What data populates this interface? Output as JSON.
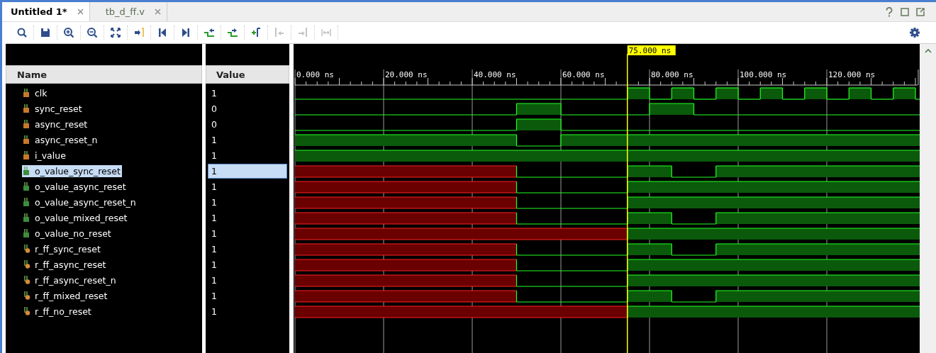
{
  "tabs": [
    {
      "label": "Untitled 1*",
      "selected": true
    },
    {
      "label": "tb_d_ff.v",
      "selected": false
    }
  ],
  "toolbar": [
    {
      "kind": "search",
      "disabled": false
    },
    {
      "kind": "save",
      "disabled": false
    },
    {
      "kind": "zoom_in",
      "disabled": false
    },
    {
      "kind": "zoom_out",
      "disabled": false
    },
    {
      "kind": "fit",
      "disabled": false
    },
    {
      "kind": "to_cursor",
      "disabled": false
    },
    {
      "kind": "first",
      "disabled": false
    },
    {
      "kind": "last",
      "disabled": false
    },
    {
      "kind": "prev_edge",
      "disabled": false
    },
    {
      "kind": "next_edge",
      "disabled": false
    },
    {
      "kind": "add_marker",
      "disabled": false
    },
    {
      "kind": "prev_marker",
      "disabled": true
    },
    {
      "kind": "next_marker",
      "disabled": true
    },
    {
      "kind": "swap",
      "disabled": true
    }
  ],
  "columns": {
    "name": "Name",
    "value": "Value"
  },
  "cursor": {
    "label": "75.000 ns"
  },
  "time_labels": [
    "0.000 ns",
    "20.000 ns",
    "40.000 ns",
    "60.000 ns",
    "80.000 ns",
    "100.000 ns",
    "120.000 ns"
  ],
  "signals": [
    {
      "name": "clk",
      "value": "1",
      "kind": "input",
      "selected": false
    },
    {
      "name": "sync_reset",
      "value": "0",
      "kind": "input",
      "selected": false
    },
    {
      "name": "async_reset",
      "value": "0",
      "kind": "input",
      "selected": false
    },
    {
      "name": "async_reset_n",
      "value": "1",
      "kind": "input",
      "selected": false
    },
    {
      "name": "i_value",
      "value": "1",
      "kind": "input",
      "selected": false
    },
    {
      "name": "o_value_sync_reset",
      "value": "1",
      "kind": "output",
      "selected": true
    },
    {
      "name": "o_value_async_reset",
      "value": "1",
      "kind": "output",
      "selected": false
    },
    {
      "name": "o_value_async_reset_n",
      "value": "1",
      "kind": "output",
      "selected": false
    },
    {
      "name": "o_value_mixed_reset",
      "value": "1",
      "kind": "output",
      "selected": false
    },
    {
      "name": "o_value_no_reset",
      "value": "1",
      "kind": "output",
      "selected": false
    },
    {
      "name": "r_ff_sync_reset",
      "value": "1",
      "kind": "internal",
      "selected": false
    },
    {
      "name": "r_ff_async_reset",
      "value": "1",
      "kind": "internal",
      "selected": false
    },
    {
      "name": "r_ff_async_reset_n",
      "value": "1",
      "kind": "internal",
      "selected": false
    },
    {
      "name": "r_ff_mixed_reset",
      "value": "1",
      "kind": "internal",
      "selected": false
    },
    {
      "name": "r_ff_no_reset",
      "value": "1",
      "kind": "internal",
      "selected": false
    }
  ]
}
